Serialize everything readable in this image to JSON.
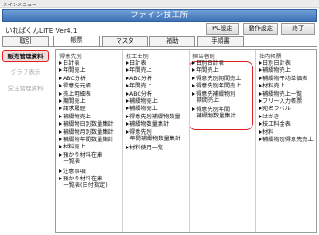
{
  "window": {
    "title": "メインメニュー"
  },
  "banner": {
    "title": "ファイン技工所"
  },
  "app": {
    "name": "いればくんLITE Ver4.1"
  },
  "buttons": {
    "pc_settings": "PC設定",
    "operation_settings": "動作設定",
    "exit": "終了"
  },
  "tabs": [
    {
      "label": "取引",
      "active": false
    },
    {
      "label": "帳票",
      "active": true
    },
    {
      "label": "マスタ",
      "active": false
    },
    {
      "label": "補助",
      "active": false
    },
    {
      "label": "手順書",
      "active": false
    }
  ],
  "sidebar": [
    {
      "label": "販売管理資料",
      "state": "active"
    },
    {
      "label": "グラフ表示",
      "state": "inactive"
    },
    {
      "label": "受注管理資料",
      "state": "inactive"
    }
  ],
  "columns": [
    {
      "header": "得意先別",
      "items": [
        [
          "日計表"
        ],
        [
          "年間売上"
        ],
        [
          "ABC分析"
        ],
        [
          "得意先元帳"
        ],
        [
          "売上明細表"
        ],
        [
          "期間売上"
        ],
        [
          "請求履歴"
        ],
        [
          "補綴物売上"
        ],
        [
          "補綴物日別数量集計"
        ],
        [
          "補綴物月別数量集計"
        ],
        [
          "補綴物年間数量集計"
        ],
        [
          "材料売上"
        ],
        [
          "預かり材料在庫",
          "一覧表"
        ],
        [
          "注意事項"
        ],
        [
          "預かり材料在庫",
          "一覧表(日付指定)"
        ]
      ]
    },
    {
      "header": "技工士別",
      "items": [
        [
          "日計表"
        ],
        [
          "年間売上"
        ],
        [
          "ABC分析"
        ],
        [
          "年間売上"
        ],
        [
          "ABC分析"
        ],
        [
          "補綴物売上"
        ],
        [
          "補綴物売上"
        ],
        [
          "得意先別補綴物数量"
        ],
        [
          "補綴物数量集計"
        ],
        [
          "得意先別",
          "年間補綴物数量集計"
        ],
        [
          "材料使用一覧"
        ]
      ]
    },
    {
      "header": "担当者別",
      "items": [
        [
          "日別日計表"
        ],
        [
          "年間売上"
        ],
        [
          "得意先別期間売上"
        ],
        [
          "得意先別年間売上"
        ],
        [
          "得意先補綴物別",
          "期間売上"
        ],
        [
          "得意先別年間",
          "補綴物数量集計"
        ]
      ]
    },
    {
      "header": "社内帳票",
      "items": [
        [
          "日別日計表"
        ],
        [
          "補綴物売上"
        ],
        [
          "補綴物平均単価表"
        ],
        [
          "材料売上"
        ],
        [
          "補綴物売上一覧"
        ],
        [
          "フリー入力帳票"
        ],
        [
          "宛名ラベル"
        ],
        [
          "はがき"
        ],
        [
          "技工料金表"
        ],
        [
          "材料"
        ],
        [
          "補綴物別得意先売上"
        ]
      ]
    }
  ]
}
